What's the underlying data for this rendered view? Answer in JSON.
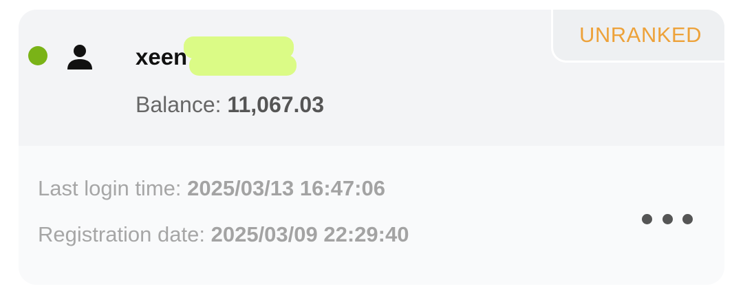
{
  "account": {
    "status": "online",
    "status_color": "#7ab317",
    "icon": "user-icon",
    "username": "xeen",
    "balance_label": "Balance:",
    "balance_value": "11,067.03",
    "rank": "UNRANKED",
    "rank_color": "#eda23a"
  },
  "details": {
    "last_login_label": "Last login time:",
    "last_login_value": "2025/03/13 16:47:06",
    "registration_label": "Registration date:",
    "registration_value": "2025/03/09 22:29:40"
  },
  "actions": {
    "more_icon": "more-dots-icon"
  }
}
